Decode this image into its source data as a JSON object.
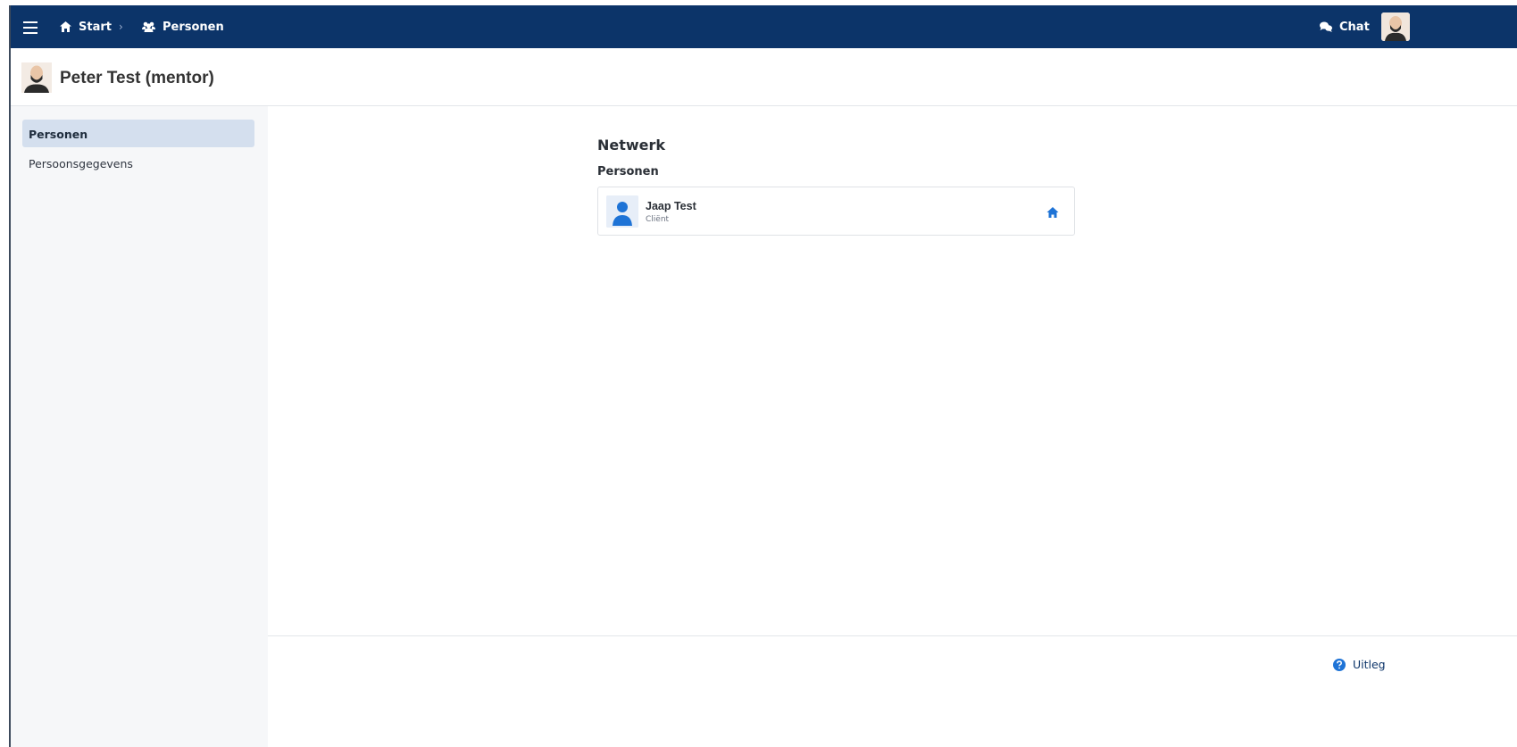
{
  "topbar": {
    "breadcrumb": [
      {
        "label": "Start",
        "icon": "home-icon"
      },
      {
        "label": "Personen",
        "icon": "people-icon"
      }
    ],
    "separator": "›",
    "chat_label": "Chat"
  },
  "header": {
    "title": "Peter Test (mentor)"
  },
  "sidebar": {
    "items": [
      {
        "label": "Personen",
        "active": true
      },
      {
        "label": "Persoonsgegevens",
        "active": false
      }
    ]
  },
  "main": {
    "heading": "Netwerk",
    "subheading": "Personen",
    "persons": [
      {
        "name": "Jaap Test",
        "role": "Cliënt",
        "icon": "home-icon"
      }
    ]
  },
  "footer": {
    "help_label": "Uitleg"
  },
  "colors": {
    "topbar": "#0c3469",
    "accent": "#1e73d6",
    "sidebar_active": "#d4dfee"
  }
}
